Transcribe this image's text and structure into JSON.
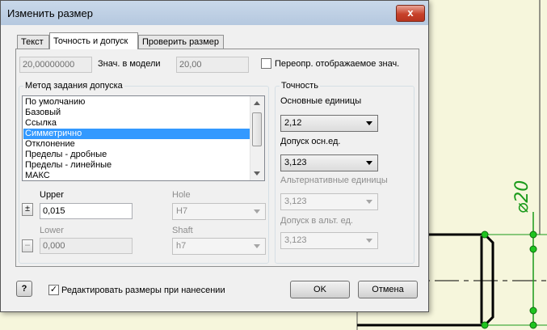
{
  "window": {
    "title": "Изменить размер",
    "close_glyph": "x"
  },
  "tabs": [
    {
      "label": "Текст",
      "active": false
    },
    {
      "label": "Точность и допуск",
      "active": true
    },
    {
      "label": "Проверить размер",
      "active": false
    }
  ],
  "model_value": {
    "value": "20,00000000",
    "label": "Знач. в модели",
    "display_value": "20,00",
    "override_label": "Переопр. отображаемое знач.",
    "override_checked": false
  },
  "tolerance_method": {
    "title": "Метод задания допуска",
    "items": [
      "По умолчанию",
      "Базовый",
      "Ссылка",
      "Симметрично",
      "Отклонение",
      "Пределы - дробные",
      "Пределы - линейные",
      "МАКС"
    ],
    "selected_index": 3
  },
  "limits": {
    "upper_label": "Upper",
    "upper_value": "0,015",
    "upper_button_glyph": "±",
    "lower_label": "Lower",
    "lower_value": "0,000",
    "lower_button_glyph": "–",
    "hole_label": "Hole",
    "hole_value": "H7",
    "shaft_label": "Shaft",
    "shaft_value": "h7"
  },
  "precision": {
    "title": "Точность",
    "primary_units_label": "Основные единицы",
    "primary_units_value": "2,12",
    "primary_tol_label": "Допуск осн.ед.",
    "primary_tol_value": "3,123",
    "alt_units_label": "Альтернативные единицы",
    "alt_units_value": "3,123",
    "alt_tol_label": "Допуск в альт. ед.",
    "alt_tol_value": "3,123"
  },
  "footer": {
    "help_glyph": "?",
    "edit_on_place_label": "Редактировать размеры при нанесении",
    "edit_on_place_checked": true,
    "ok_label": "OK",
    "cancel_label": "Отмена"
  },
  "drawing": {
    "dimension_text": "⌀20",
    "accent_color": "#1a9a1a"
  }
}
